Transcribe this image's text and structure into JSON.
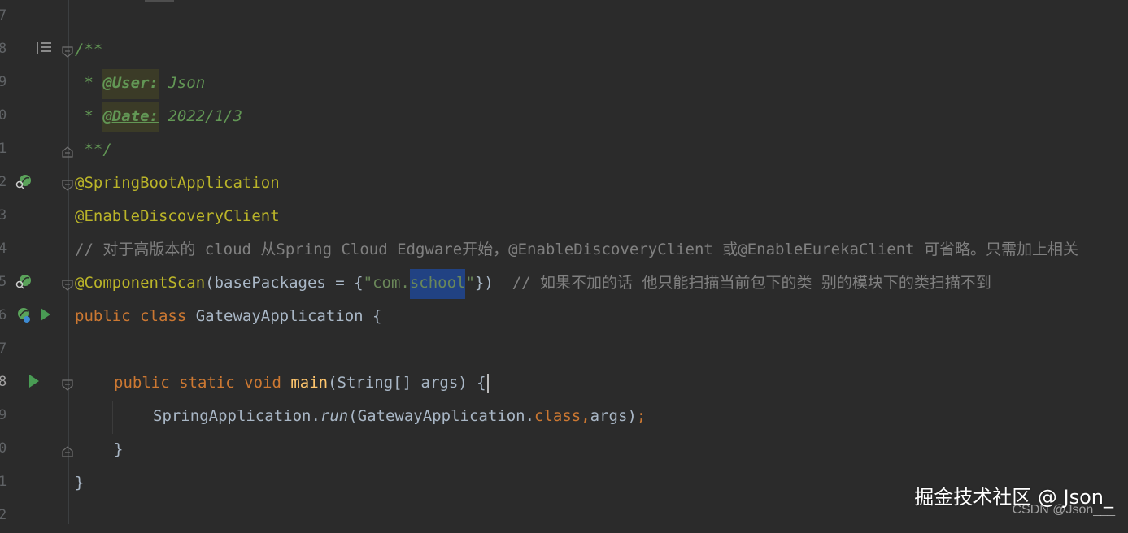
{
  "editor": {
    "line_numbers": [
      "7",
      "8",
      "9",
      "0",
      "1",
      "2",
      "3",
      "4",
      "5",
      "6",
      "7",
      "8",
      "9",
      "0",
      "1",
      "2"
    ],
    "current_line_number": "8",
    "lines": {
      "doc_open": "/**",
      "user_prefix": " * ",
      "user_tag": "@User:",
      "user_value": " Json",
      "date_prefix": " * ",
      "date_tag": "@Date:",
      "date_value": " 2022/1/3",
      "doc_close": " **/",
      "ann_springboot": "@SpringBootApplication",
      "ann_discovery": "@EnableDiscoveryClient",
      "comment_cloud": "// 对于高版本的 cloud 从Spring Cloud Edgware开始，@EnableDiscoveryClient 或@EnableEurekaClient 可省略。只需加上相关",
      "ann_componentscan": "@ComponentScan",
      "scan_args_open": "(basePackages = {",
      "scan_str_q1": "\"com.",
      "scan_str_sel": "school",
      "scan_str_q2": "\"",
      "scan_args_close": "})  ",
      "scan_comment": "// 如果不加的话 他只能扫描当前包下的类 别的模块下的类扫描不到",
      "class_kw": "public class ",
      "class_name": "GatewayApplication {",
      "main_kw": "public static void ",
      "main_fn": "main",
      "main_args": "(String[] args) {",
      "run_class": "SpringApplication.",
      "run_method": "run",
      "run_args_open": "(GatewayApplication.",
      "run_class_kw": "class",
      "run_comma": ",",
      "run_args_close": "args)",
      "run_semi": ";",
      "close_method": "}",
      "close_class": "}"
    }
  },
  "watermark": {
    "main": "掘金技术社区 @ Json_",
    "sub": "CSDN @Json___"
  },
  "colors": {
    "background": "#2b2b2b",
    "keyword": "#cc7832",
    "annotation": "#bbb529",
    "string": "#6a8759",
    "doc_comment": "#629755",
    "comment": "#808080",
    "function": "#ffc66d",
    "selection": "#214283"
  },
  "icons": [
    "bean-icon",
    "run-icon",
    "fold-icon",
    "doc-render-icon"
  ]
}
